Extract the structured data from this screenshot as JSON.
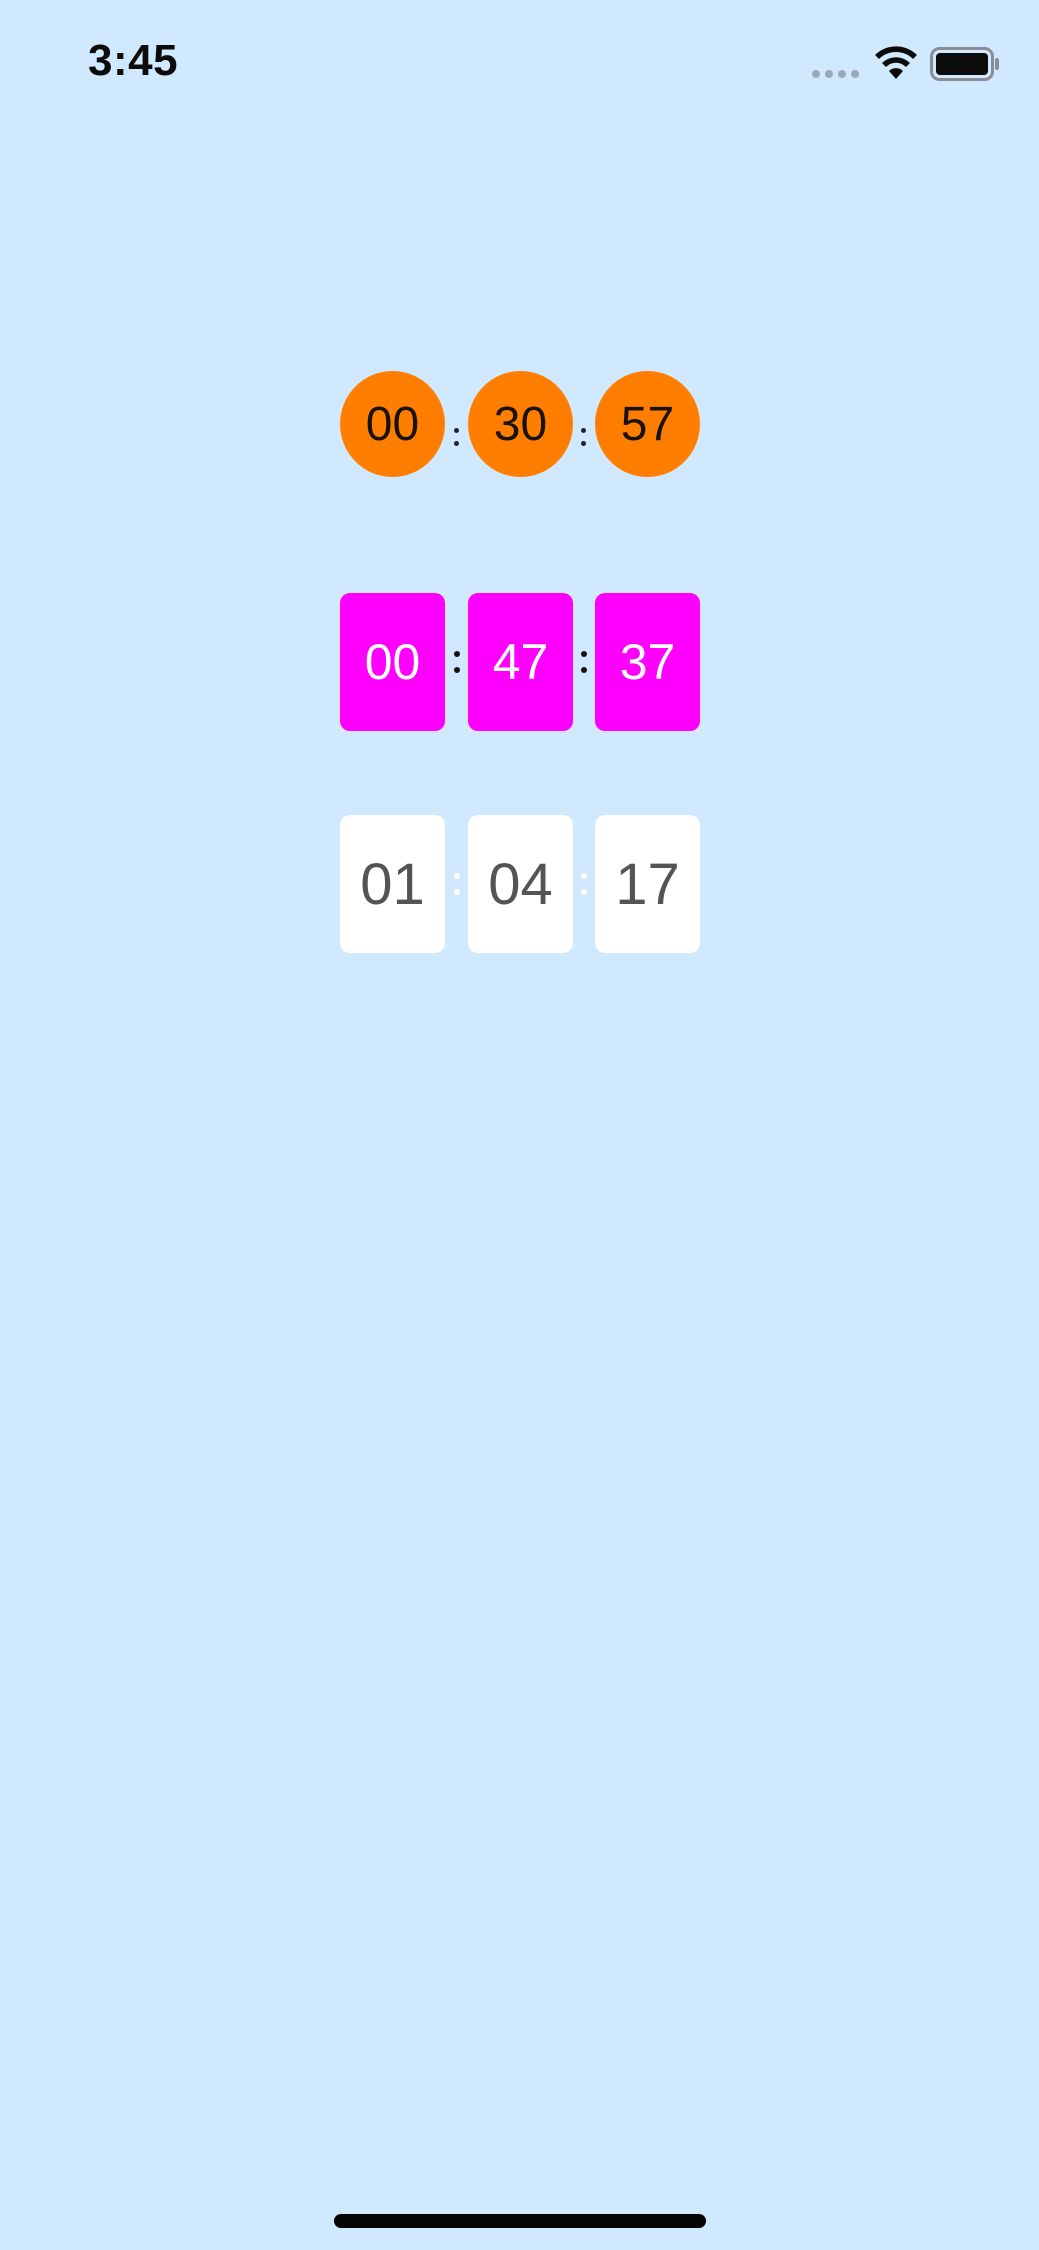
{
  "status_bar": {
    "time": "3:45",
    "icons": [
      "signal-dots-icon",
      "wifi-icon",
      "battery-icon"
    ]
  },
  "timers": [
    {
      "style": "circle",
      "accent": "#ff7e00",
      "text_color": "#1a1208",
      "hours": "00",
      "minutes": "30",
      "seconds": "57"
    },
    {
      "style": "rounded-rect",
      "accent": "#ff00ff",
      "text_color": "#ffffff",
      "hours": "00",
      "minutes": "47",
      "seconds": "37"
    },
    {
      "style": "rounded-rect",
      "accent": "#ffffff",
      "text_color": "#545454",
      "hours": "01",
      "minutes": "04",
      "seconds": "17"
    }
  ],
  "colors": {
    "background": "#d0e9fe"
  }
}
